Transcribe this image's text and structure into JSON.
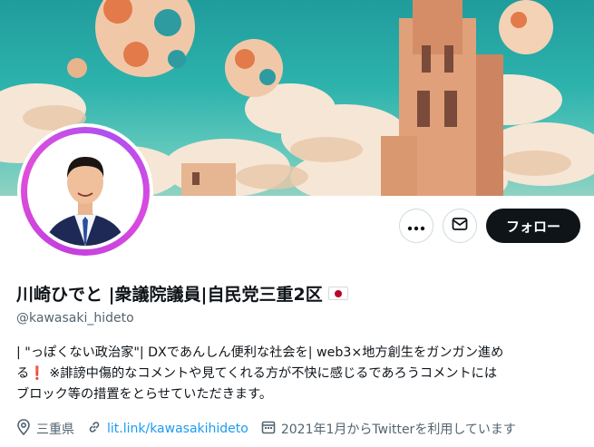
{
  "profile": {
    "name": "川崎ひでと |衆議院議員|自民党三重2区",
    "handle": "@kawasaki_hideto",
    "bio": "| \"っぽくない政治家\"|  DXであんしん便利な社会を| web3×地方創生をガンガン進め\nる❗ ※誹謗中傷的なコメントや見てくれる方が不快に感じるであろうコメントには\nブロック等の措置をとらせていただきます。",
    "location": "三重県",
    "website": "lit.link/kawasakihideto",
    "joined": "2021年1月からTwitterを利用しています"
  },
  "actions": {
    "more_icon": "more-horizontal-icon",
    "message_icon": "envelope-icon",
    "follow_label": "フォロー"
  },
  "icons": {
    "location": "location-pin-icon",
    "link": "link-icon",
    "calendar": "calendar-icon"
  },
  "colors": {
    "follow_bg": "#0f1419",
    "link": "#1d9bf0",
    "secondary_text": "#536471",
    "avatar_ring": "#c43fe0"
  }
}
